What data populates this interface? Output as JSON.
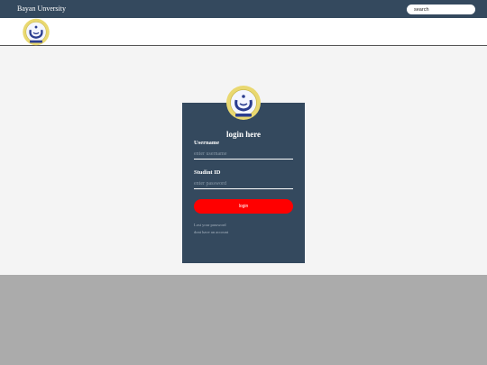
{
  "topbar": {
    "brand": "Bayan Unversity",
    "search_placeholder": "search"
  },
  "logo": {
    "icon": "university-crest-icon",
    "colors": {
      "ring": "#e9d870",
      "inner": "#f4f6ff",
      "emblem": "#2b3d8f"
    }
  },
  "login": {
    "title": "login here",
    "username_label": "Username",
    "username_placeholder": "enter username",
    "student_id_label": "Studint ID",
    "student_id_placeholder": "enter password",
    "button_label": "login",
    "lost_password_link": "Lost your password",
    "no_account_link": "dont have an account"
  },
  "colors": {
    "topbar": "#34495e",
    "card": "#34495e",
    "button": "#ff0000",
    "page_background": "#f4f4f4",
    "footer": "#ababab"
  }
}
